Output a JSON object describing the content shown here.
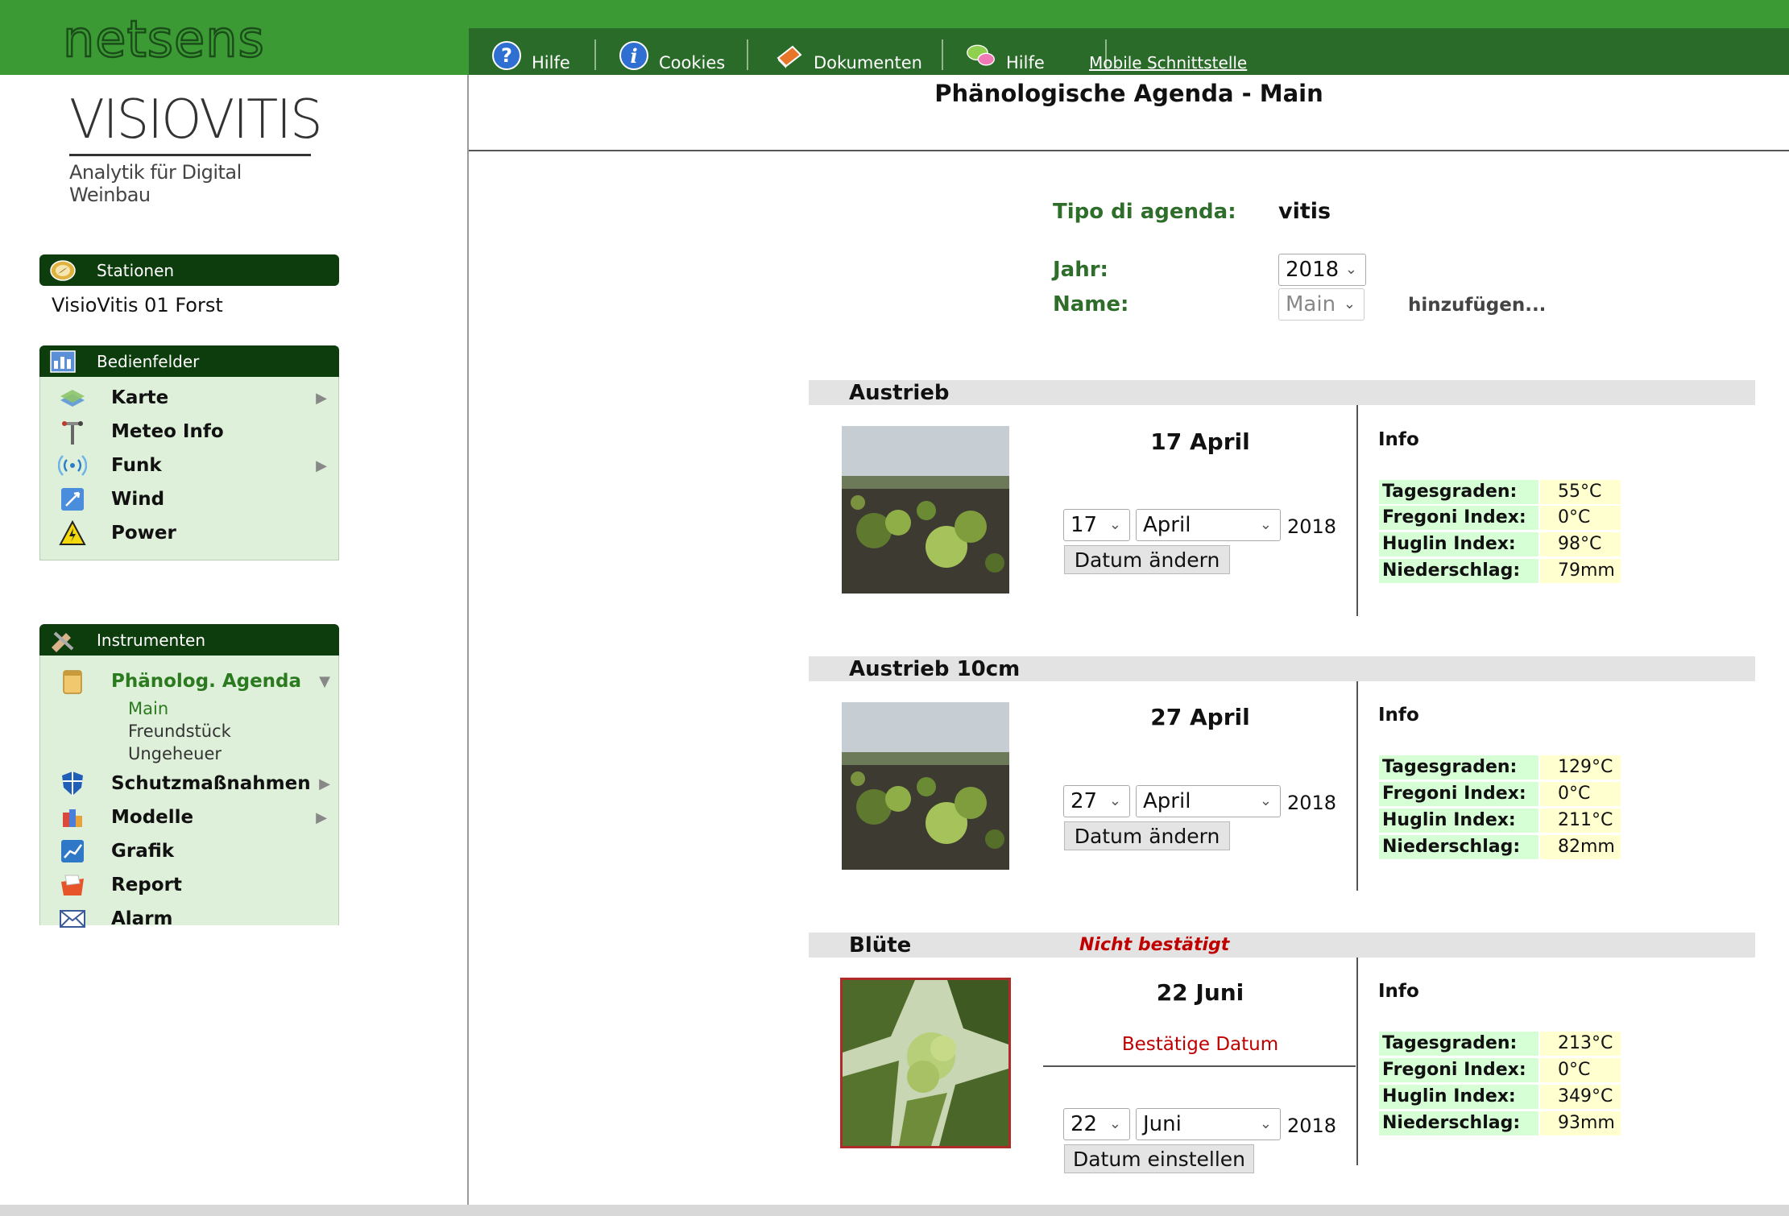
{
  "brand": {
    "logo_text": "netsens",
    "product": "VISIOVITIS",
    "tagline": "Analytik für Digital Weinbau"
  },
  "nav": [
    {
      "label": "Hilfe",
      "icon": "help-icon"
    },
    {
      "label": "Cookies",
      "icon": "info-icon"
    },
    {
      "label": "Dokumenten",
      "icon": "book-icon"
    },
    {
      "label": "Hilfe",
      "icon": "chat-icon"
    },
    {
      "label": "Mobile Schnittstelle"
    }
  ],
  "sidebar": {
    "stationen": {
      "title": "Stationen",
      "station": "VisioVitis 01 Forst"
    },
    "bedienfelder": {
      "title": "Bedienfelder",
      "items": [
        "Karte",
        "Meteo Info",
        "Funk",
        "Wind",
        "Power"
      ]
    },
    "instrumenten": {
      "title": "Instrumenten",
      "agenda": "Phänolog. Agenda",
      "agenda_subitems": [
        "Main",
        "Freundstück",
        "Ungeheuer"
      ],
      "items": [
        "Schutzmaßnahmen",
        "Modelle",
        "Grafik",
        "Report",
        "Alarm"
      ]
    }
  },
  "main": {
    "title": "Phänologische Agenda - Main",
    "tipo_label": "Tipo di agenda:",
    "tipo_value": "vitis",
    "jahr_label": "Jahr:",
    "jahr_value": "2018",
    "name_label": "Name:",
    "name_value": "Main",
    "add_label": "hinzufügen...",
    "info_title": "Info",
    "keys": {
      "tagesgraden": "Tagesgraden:",
      "fregoni": "Fregoni Index:",
      "huglin": "Huglin Index:",
      "niederschlag": "Niederschlag:"
    },
    "stages": [
      {
        "name": "Austrieb",
        "status": "",
        "date": "17 April",
        "day": "17",
        "month": "April",
        "year": "2018",
        "button": "Datum ändern",
        "confirm": "",
        "tagesgraden": "55°C",
        "fregoni": "0°C",
        "huglin": "98°C",
        "niederschlag": "79mm"
      },
      {
        "name": "Austrieb 10cm",
        "status": "",
        "date": "27 April",
        "day": "27",
        "month": "April",
        "year": "2018",
        "button": "Datum ändern",
        "confirm": "",
        "tagesgraden": "129°C",
        "fregoni": "0°C",
        "huglin": "211°C",
        "niederschlag": "82mm"
      },
      {
        "name": "Blüte",
        "status": "Nicht bestätigt",
        "date": "22 Juni",
        "day": "22",
        "month": "Juni",
        "year": "2018",
        "button": "Datum einstellen",
        "confirm": "Bestätige Datum",
        "tagesgraden": "213°C",
        "fregoni": "0°C",
        "huglin": "349°C",
        "niederschlag": "93mm"
      }
    ]
  },
  "colors": {
    "brand_green": "#3c9a34",
    "nav_green": "#2a6b2a",
    "panel_dark": "#0d3d0d",
    "panel_light": "#dff0da",
    "label_green": "#2e6d2a",
    "warning_red": "#c00000"
  }
}
